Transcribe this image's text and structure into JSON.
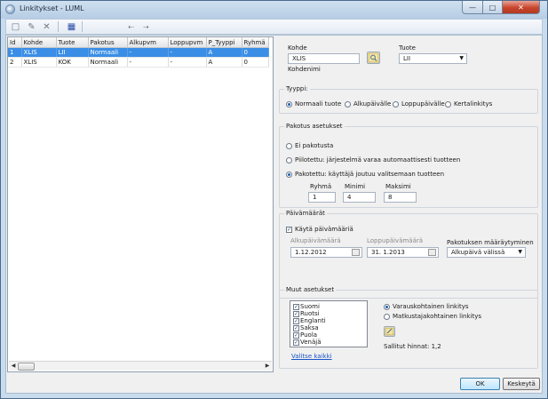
{
  "window": {
    "title": "Linkitykset - LUML"
  },
  "grid": {
    "columns": [
      "Id",
      "Kohde",
      "Tuote",
      "Pakotus",
      "Alkupvm",
      "Loppupvm",
      "P_Tyyppi",
      "Ryhmä"
    ],
    "rows": [
      [
        "1",
        "XLIS",
        "LII",
        "Normaali",
        "-",
        "-",
        "A",
        "0"
      ],
      [
        "2",
        "XLIS",
        "KOK",
        "Normaali",
        "-",
        "-",
        "A",
        "0"
      ]
    ]
  },
  "form": {
    "kohde_label": "Kohde",
    "kohde_value": "XLIS",
    "kohdenimi_label": "Kohdenimi",
    "tuote_label": "Tuote",
    "tuote_value": "LII"
  },
  "tyyppi": {
    "title": "Tyyppi:",
    "options": [
      "Normaali tuote",
      "Alkupäivälle",
      "Loppupäivälle",
      "Kertalinkitys"
    ],
    "selected": 0
  },
  "pakotus": {
    "title": "Pakotus asetukset",
    "options": [
      "Ei pakotusta",
      "Piilotettu: järjestelmä varaa automaattisesti tuotteen",
      "Pakotettu: käyttäjä joutuu valitsemaan tuotteen"
    ],
    "selected": 2,
    "ryhma_label": "Ryhmä",
    "ryhma_value": "1",
    "minimi_label": "Minimi",
    "minimi_value": "4",
    "maksimi_label": "Maksimi",
    "maksimi_value": "8"
  },
  "paivamaarat": {
    "title": "Päivämäärät",
    "use_label": "Käytä päivämääriä",
    "alku_label": "Alkupäivämäärä",
    "alku_value": "1.12.2012",
    "loppu_label": "Loppupäivämäärä",
    "loppu_value": "31. 1.2013",
    "maaraytyminen_label": "Pakotuksen määräytyminen",
    "maaraytyminen_value": "Alkupäivä välissä"
  },
  "muut": {
    "title": "Muut asetukset",
    "languages": [
      "Suomi",
      "Ruotsi",
      "Englanti",
      "Saksa",
      "Puola",
      "Venäjä"
    ],
    "select_all": "Valitse kaikki",
    "radio_options": [
      "Varauskohtainen linkitys",
      "Matkustajakohtainen linkitys"
    ],
    "radio_selected": 0,
    "sallitut": "Sallitut hinnat: 1,2"
  },
  "buttons": {
    "ok": "OK",
    "cancel": "Keskeytä"
  }
}
